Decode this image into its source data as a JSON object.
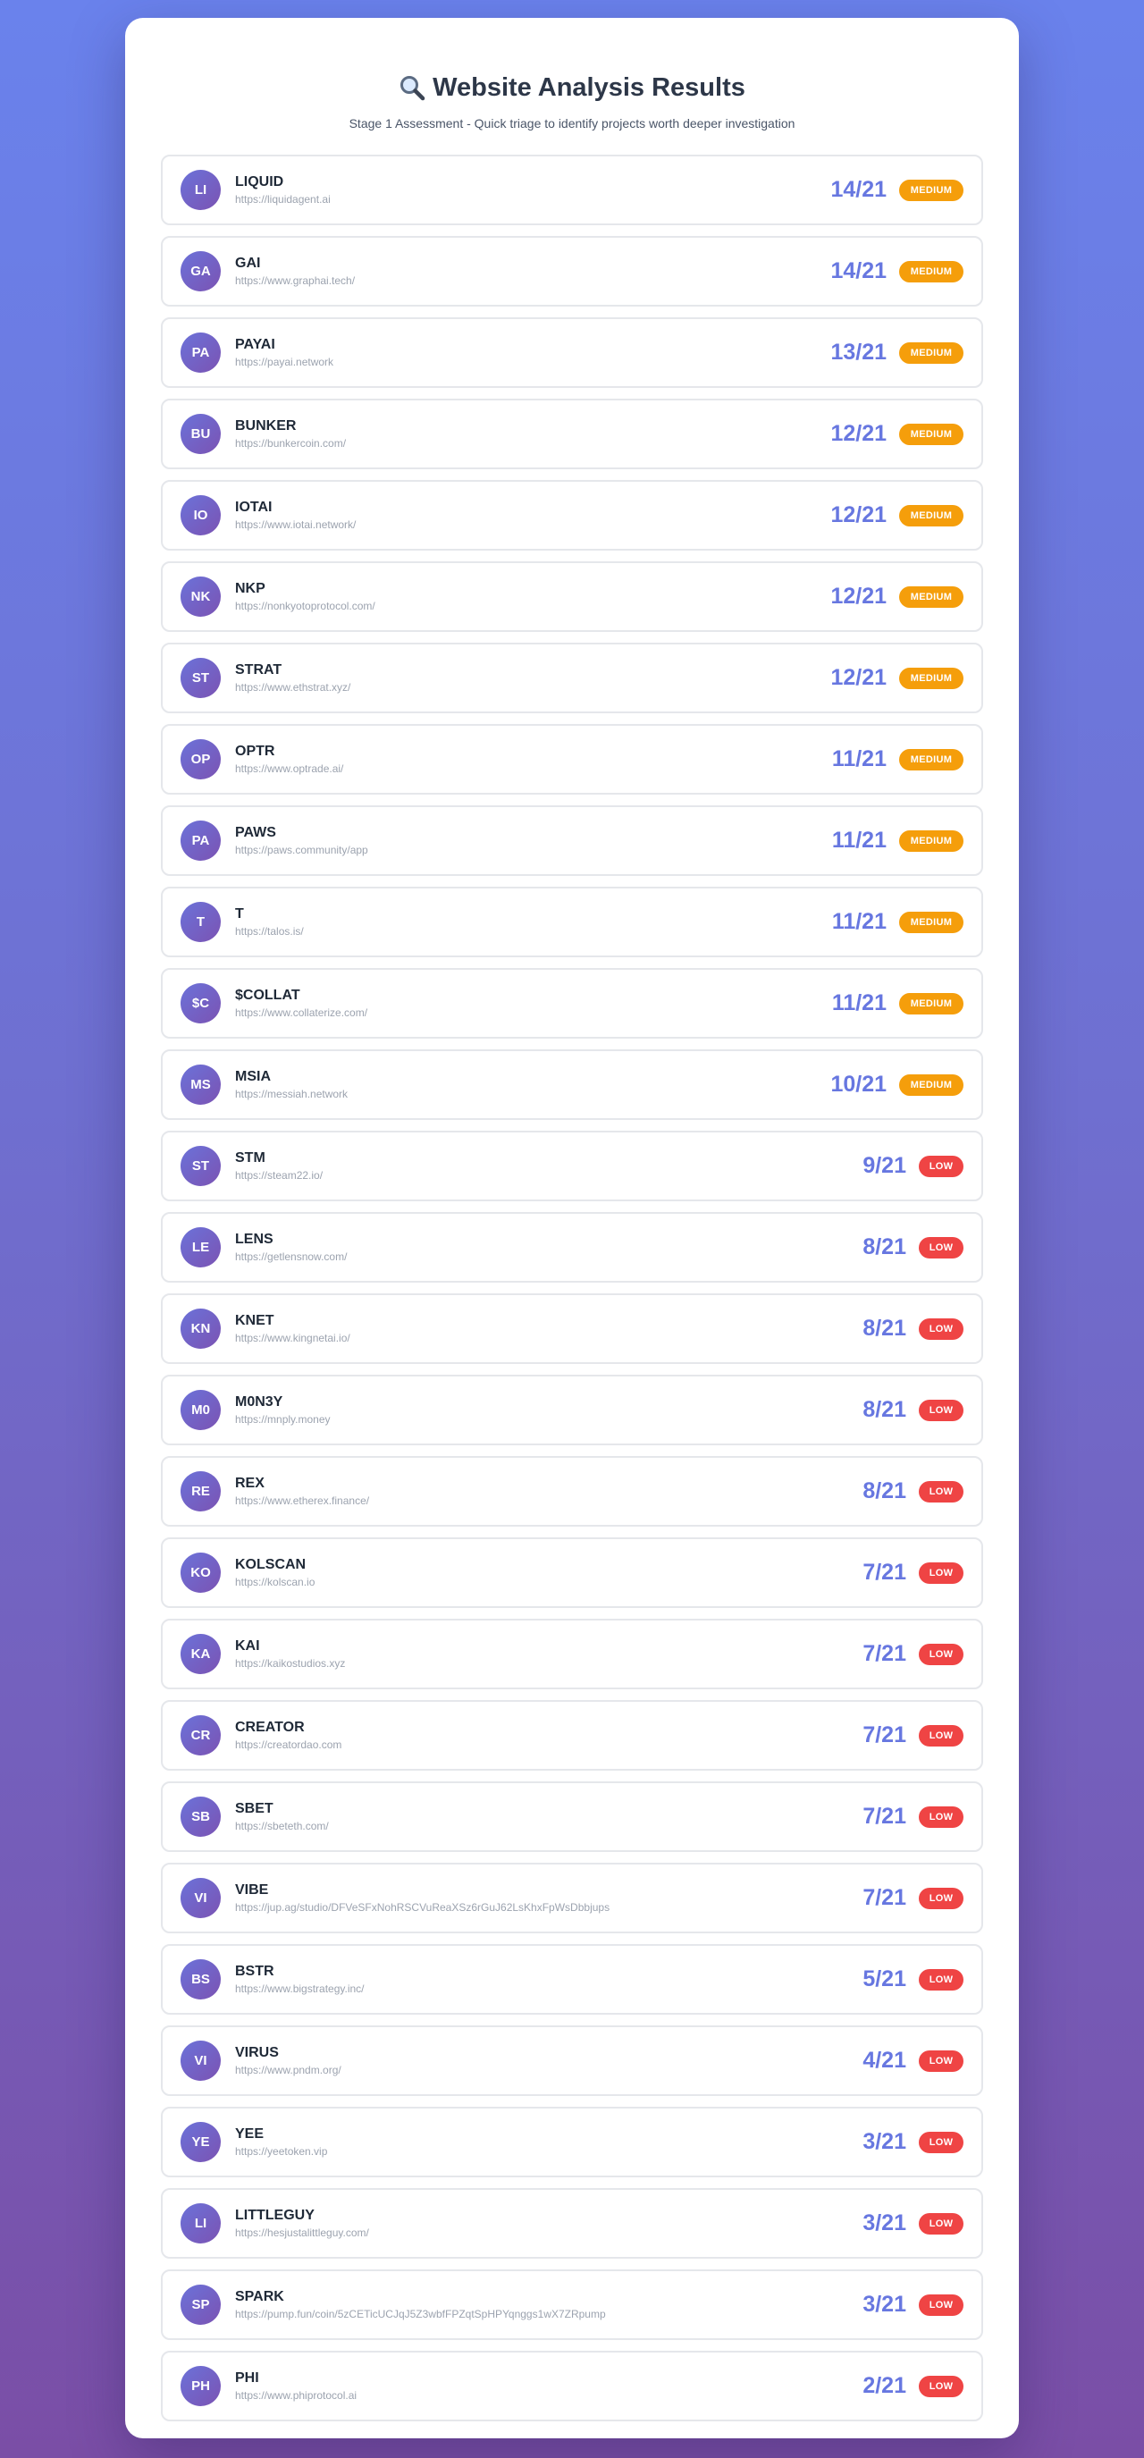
{
  "header": {
    "title": "Website Analysis Results",
    "subtitle": "Stage 1 Assessment - Quick triage to identify projects worth deeper investigation",
    "icon": "magnifier-icon"
  },
  "colors": {
    "accent": "#6777e0",
    "medium": "#f59e0b",
    "low": "#ef4444"
  },
  "results": [
    {
      "initials": "LI",
      "name": "LIQUID",
      "url": "https://liquidagent.ai",
      "score": "14/21",
      "rating": "MEDIUM"
    },
    {
      "initials": "GA",
      "name": "GAI",
      "url": "https://www.graphai.tech/",
      "score": "14/21",
      "rating": "MEDIUM"
    },
    {
      "initials": "PA",
      "name": "PAYAI",
      "url": "https://payai.network",
      "score": "13/21",
      "rating": "MEDIUM"
    },
    {
      "initials": "BU",
      "name": "BUNKER",
      "url": "https://bunkercoin.com/",
      "score": "12/21",
      "rating": "MEDIUM"
    },
    {
      "initials": "IO",
      "name": "IOTAI",
      "url": "https://www.iotai.network/",
      "score": "12/21",
      "rating": "MEDIUM"
    },
    {
      "initials": "NK",
      "name": "NKP",
      "url": "https://nonkyotoprotocol.com/",
      "score": "12/21",
      "rating": "MEDIUM"
    },
    {
      "initials": "ST",
      "name": "STRAT",
      "url": "https://www.ethstrat.xyz/",
      "score": "12/21",
      "rating": "MEDIUM"
    },
    {
      "initials": "OP",
      "name": "OPTR",
      "url": "https://www.optrade.ai/",
      "score": "11/21",
      "rating": "MEDIUM"
    },
    {
      "initials": "PA",
      "name": "PAWS",
      "url": "https://paws.community/app",
      "score": "11/21",
      "rating": "MEDIUM"
    },
    {
      "initials": "T",
      "name": "T",
      "url": "https://talos.is/",
      "score": "11/21",
      "rating": "MEDIUM"
    },
    {
      "initials": "$C",
      "name": "$COLLAT",
      "url": "https://www.collaterize.com/",
      "score": "11/21",
      "rating": "MEDIUM"
    },
    {
      "initials": "MS",
      "name": "MSIA",
      "url": "https://messiah.network",
      "score": "10/21",
      "rating": "MEDIUM"
    },
    {
      "initials": "ST",
      "name": "STM",
      "url": "https://steam22.io/",
      "score": "9/21",
      "rating": "LOW"
    },
    {
      "initials": "LE",
      "name": "LENS",
      "url": "https://getlensnow.com/",
      "score": "8/21",
      "rating": "LOW"
    },
    {
      "initials": "KN",
      "name": "KNET",
      "url": "https://www.kingnetai.io/",
      "score": "8/21",
      "rating": "LOW"
    },
    {
      "initials": "M0",
      "name": "M0N3Y",
      "url": "https://mnply.money",
      "score": "8/21",
      "rating": "LOW"
    },
    {
      "initials": "RE",
      "name": "REX",
      "url": "https://www.etherex.finance/",
      "score": "8/21",
      "rating": "LOW"
    },
    {
      "initials": "KO",
      "name": "KOLSCAN",
      "url": "https://kolscan.io",
      "score": "7/21",
      "rating": "LOW"
    },
    {
      "initials": "KA",
      "name": "KAI",
      "url": "https://kaikostudios.xyz",
      "score": "7/21",
      "rating": "LOW"
    },
    {
      "initials": "CR",
      "name": "CREATOR",
      "url": "https://creatordao.com",
      "score": "7/21",
      "rating": "LOW"
    },
    {
      "initials": "SB",
      "name": "SBET",
      "url": "https://sbeteth.com/",
      "score": "7/21",
      "rating": "LOW"
    },
    {
      "initials": "VI",
      "name": "VIBE",
      "url": "https://jup.ag/studio/DFVeSFxNohRSCVuReaXSz6rGuJ62LsKhxFpWsDbbjups",
      "score": "7/21",
      "rating": "LOW"
    },
    {
      "initials": "BS",
      "name": "BSTR",
      "url": "https://www.bigstrategy.inc/",
      "score": "5/21",
      "rating": "LOW"
    },
    {
      "initials": "VI",
      "name": "VIRUS",
      "url": "https://www.pndm.org/",
      "score": "4/21",
      "rating": "LOW"
    },
    {
      "initials": "YE",
      "name": "YEE",
      "url": "https://yeetoken.vip",
      "score": "3/21",
      "rating": "LOW"
    },
    {
      "initials": "LI",
      "name": "LITTLEGUY",
      "url": "https://hesjustalittleguy.com/",
      "score": "3/21",
      "rating": "LOW"
    },
    {
      "initials": "SP",
      "name": "SPARK",
      "url": "https://pump.fun/coin/5zCETicUCJqJ5Z3wbfFPZqtSpHPYqnggs1wX7ZRpump",
      "score": "3/21",
      "rating": "LOW"
    },
    {
      "initials": "PH",
      "name": "PHI",
      "url": "https://www.phiprotocol.ai",
      "score": "2/21",
      "rating": "LOW"
    }
  ]
}
